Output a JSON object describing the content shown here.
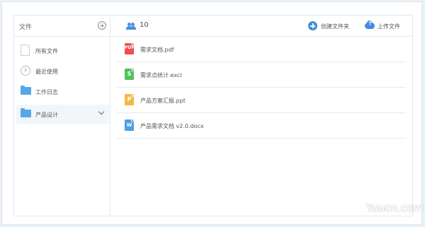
{
  "sidebar": {
    "title": "文件",
    "add_icon": "plus-circle-icon",
    "items": [
      {
        "label": "所有文件",
        "icon": "document-icon"
      },
      {
        "label": "最近使用",
        "icon": "recent-icon"
      },
      {
        "label": "工作日志",
        "icon": "folder-icon"
      },
      {
        "label": "产品设计",
        "icon": "folder-icon",
        "active": true
      }
    ]
  },
  "toolbar": {
    "member_count": "10",
    "create_folder_label": "创建文件夹",
    "upload_label": "上传文件"
  },
  "files": [
    {
      "name": "需求文档.pdf",
      "type": "pdf",
      "glyph": "PDF",
      "color": "#f04d4d"
    },
    {
      "name": "需求点统计.excl",
      "type": "excel",
      "glyph": "S",
      "color": "#4fc35a"
    },
    {
      "name": "产品方案汇报.ppt",
      "type": "ppt",
      "glyph": "P",
      "color": "#f5b840"
    },
    {
      "name": "产品需求文档 v2.0.docx",
      "type": "word",
      "glyph": "W",
      "color": "#4a9fe8"
    }
  ],
  "watermark": "Yuucn.com",
  "colors": {
    "accent": "#3f8edc",
    "folder": "#5aa7e6",
    "active_bg": "#f1f6fa"
  }
}
